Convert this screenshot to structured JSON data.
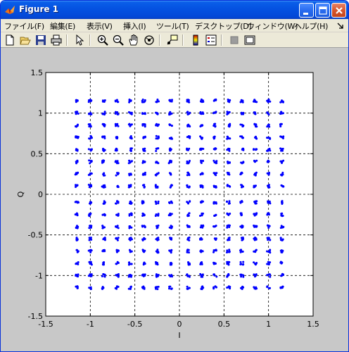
{
  "window": {
    "title": "Figure 1"
  },
  "menu": [
    {
      "label": "ファイル(F)"
    },
    {
      "label": "編集(E)"
    },
    {
      "label": "表示(V)"
    },
    {
      "label": "挿入(I)"
    },
    {
      "label": "ツール(T)"
    },
    {
      "label": "デスクトップ(D)"
    },
    {
      "label": "ウィンドウ(W)"
    },
    {
      "label": "ヘルプ(H)"
    }
  ],
  "toolbar_icons": [
    "new-figure-icon",
    "open-file-icon",
    "save-icon",
    "print-icon",
    "pointer-icon",
    "zoom-in-icon",
    "zoom-out-icon",
    "pan-hand-icon",
    "rotate-3d-icon",
    "data-cursor-icon",
    "colorbar-icon",
    "legend-icon",
    "hide-plot-tools-icon",
    "show-plot-tools-icon"
  ],
  "colors": {
    "marker": "#0000ff",
    "titlebar": "#0553e2"
  },
  "chart_data": {
    "type": "scatter",
    "xlabel": "I",
    "ylabel": "Q",
    "xlim": [
      -1.5,
      1.5
    ],
    "ylim": [
      -1.5,
      1.5
    ],
    "xticks": [
      -1.5,
      -1,
      -0.5,
      0,
      0.5,
      1,
      1.5
    ],
    "yticks": [
      -1.5,
      -1,
      -0.5,
      0,
      0.5,
      1,
      1.5
    ],
    "grid": true,
    "grid_positions": [
      -1,
      -0.5,
      0,
      0.5,
      1
    ],
    "constellation_levels": [
      -1.15,
      -1.0,
      -0.85,
      -0.7,
      -0.55,
      -0.4,
      -0.25,
      -0.1,
      0.1,
      0.25,
      0.4,
      0.55,
      0.7,
      0.85,
      1.0,
      1.15
    ]
  }
}
